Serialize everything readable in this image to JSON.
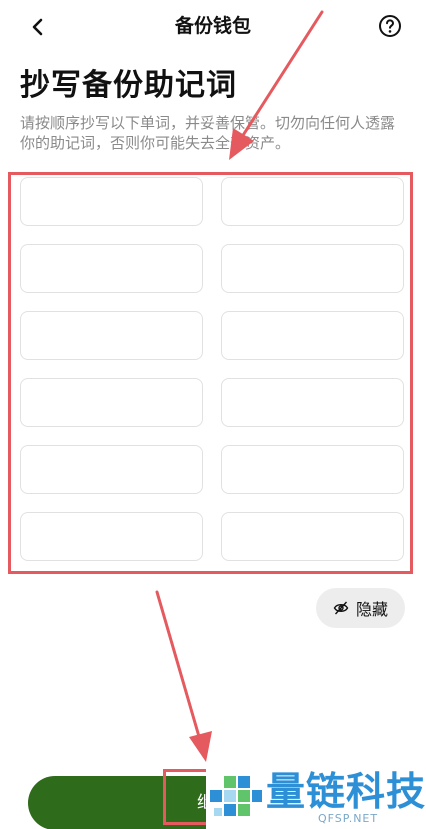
{
  "header": {
    "title": "备份钱包",
    "back_icon": "chevron-left-icon",
    "help_icon": "help-circle-icon"
  },
  "main": {
    "title": "抄写备份助记词",
    "description": "请按顺序抄写以下单词，并妥善保管。切勿向任何人透露你的助记词，否则你可能失去全部资产。",
    "mnemonic_words": [
      "",
      "",
      "",
      "",
      "",
      "",
      "",
      "",
      "",
      "",
      "",
      ""
    ]
  },
  "hide_button": {
    "label": "隐藏",
    "icon": "eye-off-icon"
  },
  "footer": {
    "continue_label": "继"
  },
  "watermark": {
    "name": "量链科技",
    "domain": "QFSP.NET"
  },
  "colors": {
    "accent_green": "#2e6b1b",
    "annotation_red": "#e55a5e",
    "watermark_blue": "#2d8fd6",
    "text_gray": "#8a8a8a"
  }
}
